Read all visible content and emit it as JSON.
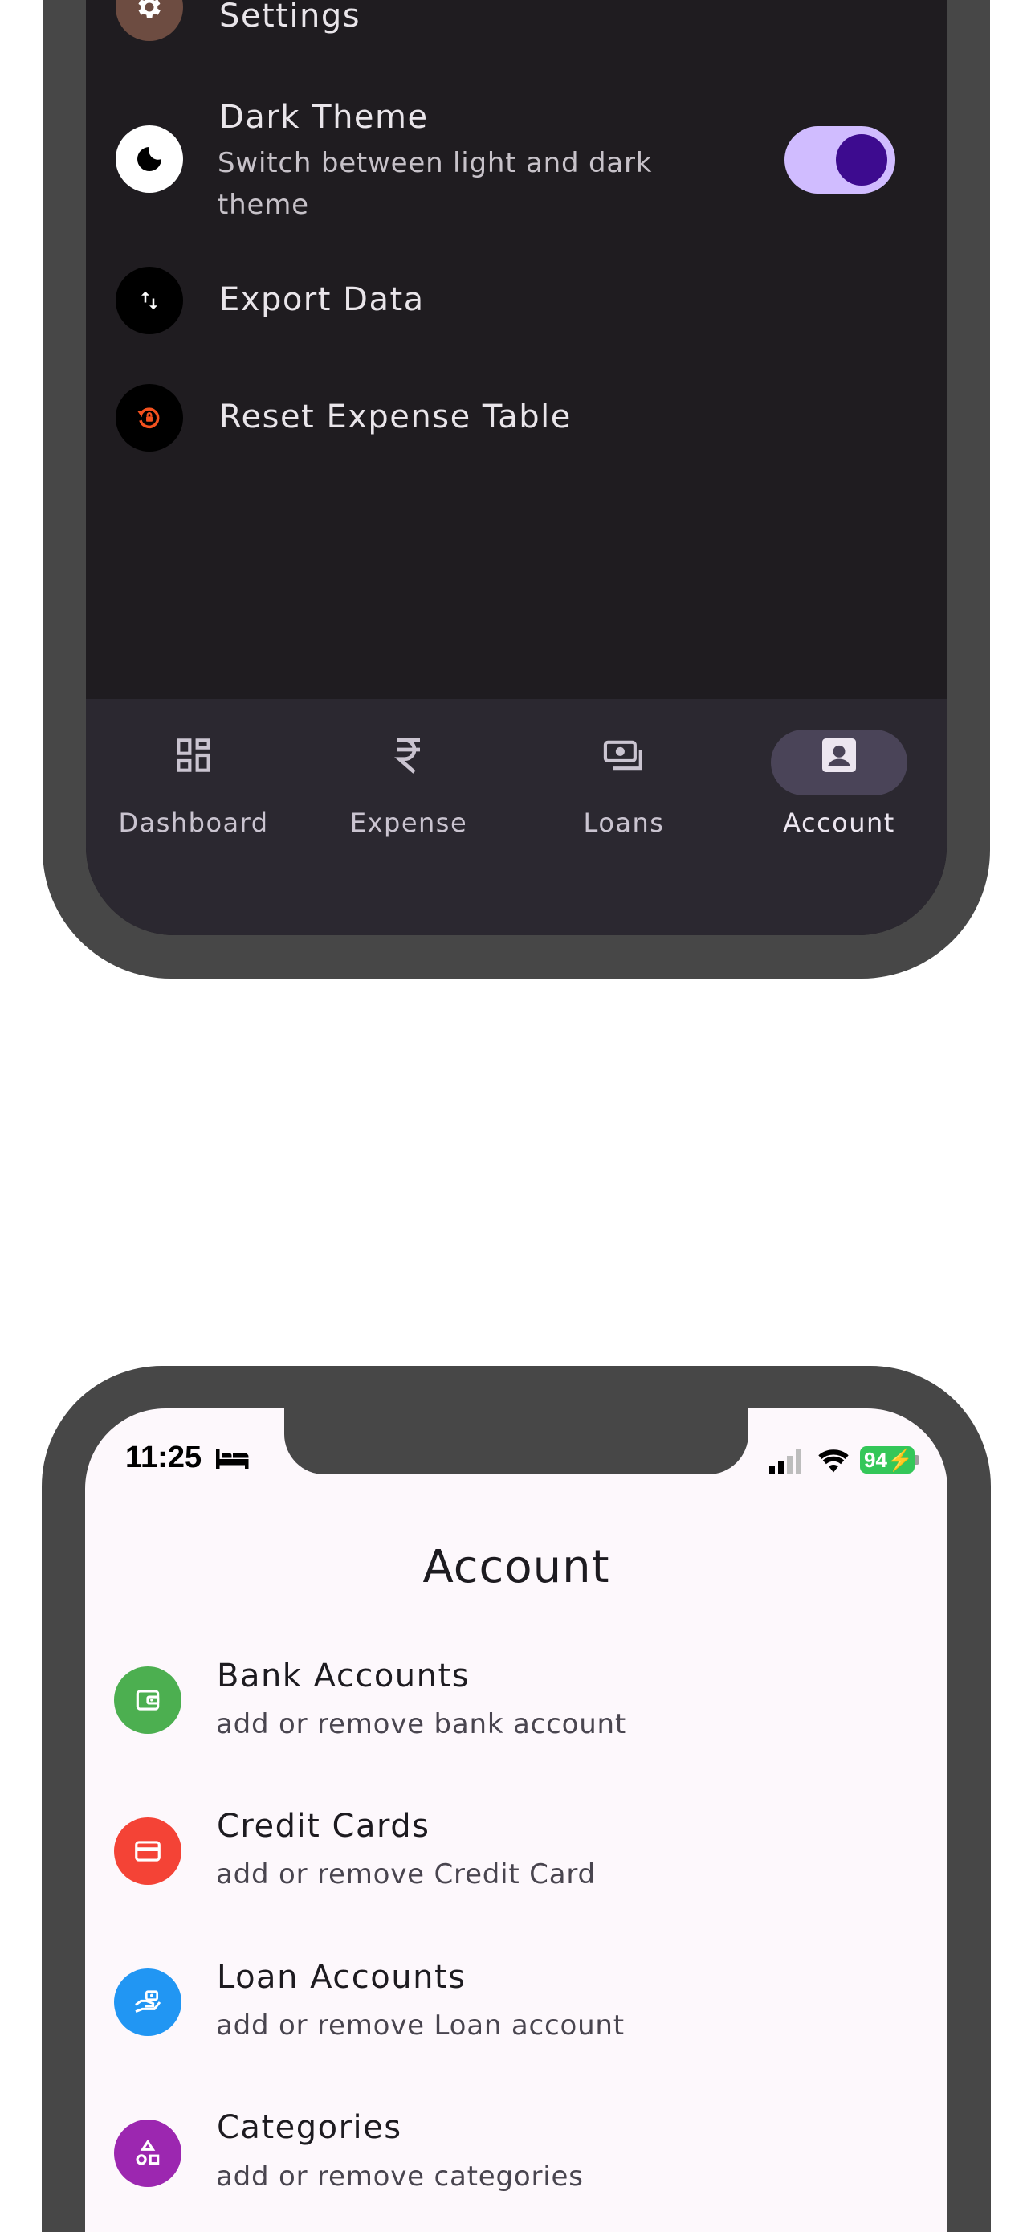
{
  "top_screen": {
    "rows": [
      {
        "title": "Settings",
        "icon": "gear-icon",
        "icon_bg": "#6d4c41"
      },
      {
        "title": "Dark Theme",
        "subtitle": "Switch between light and dark theme",
        "icon": "moon-icon",
        "icon_bg": "#ffffff",
        "toggle_on": true
      },
      {
        "title": "Export Data",
        "icon": "swap-vertical-icon",
        "icon_bg": "#000000"
      },
      {
        "title": "Reset Expense Table",
        "icon": "reset-icon",
        "icon_bg": "#000000",
        "icon_color": "#f4511e"
      }
    ],
    "bottom_nav": [
      {
        "label": "Dashboard",
        "icon": "dashboard-icon"
      },
      {
        "label": "Expense",
        "icon": "rupee-icon"
      },
      {
        "label": "Loans",
        "icon": "payments-icon"
      },
      {
        "label": "Account",
        "icon": "account-box-icon",
        "active": true
      }
    ]
  },
  "bottom_screen": {
    "status_bar": {
      "time": "11:25",
      "battery": "94"
    },
    "title": "Account",
    "rows": [
      {
        "title": "Bank Accounts",
        "subtitle": "add or remove bank account",
        "icon": "wallet-icon",
        "icon_bg": "#4caf50"
      },
      {
        "title": "Credit Cards",
        "subtitle": "add or remove Credit Card",
        "icon": "credit-card-icon",
        "icon_bg": "#f44336"
      },
      {
        "title": "Loan Accounts",
        "subtitle": "add or remove Loan account",
        "icon": "loan-hand-icon",
        "icon_bg": "#2196f3"
      },
      {
        "title": "Categories",
        "subtitle": "add or remove categories",
        "icon": "category-icon",
        "icon_bg": "#9c27b0"
      }
    ]
  }
}
